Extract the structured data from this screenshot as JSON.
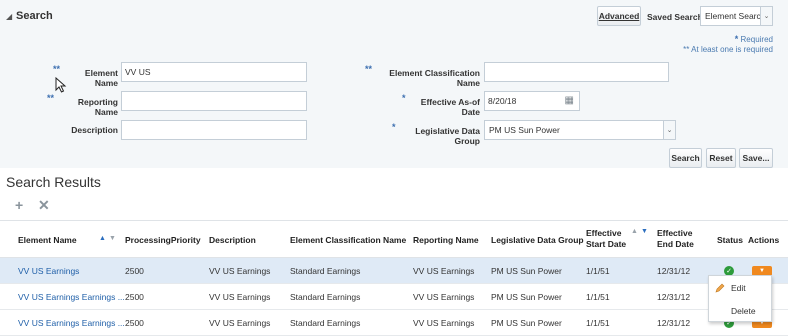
{
  "search": {
    "title": "Search",
    "advanced_label": "Advanced",
    "saved_search_label": "Saved Search",
    "saved_search_value": "Element Search",
    "required_note": "Required",
    "at_least_one_note": "** At least one is required",
    "fields": {
      "element_name_label": "Element Name",
      "element_name_value": "VV US",
      "reporting_name_label": "Reporting Name",
      "reporting_name_value": "",
      "description_label": "Description",
      "description_value": "",
      "classification_label": "Element Classification Name",
      "classification_value": "",
      "effective_date_label": "Effective As-of Date",
      "effective_date_value": "8/20/18",
      "ldg_label": "Legislative Data Group",
      "ldg_value": "PM US Sun Power"
    },
    "search_button": "Search",
    "reset_button": "Reset",
    "save_button": "Save..."
  },
  "results": {
    "title": "Search Results",
    "columns": {
      "element_name": "Element Name",
      "processing_priority": "ProcessingPriority",
      "description": "Description",
      "classification": "Element Classification Name",
      "reporting_name": "Reporting Name",
      "ldg": "Legislative Data Group",
      "start_date_1": "Effective",
      "start_date_2": "Start Date",
      "end_date_1": "Effective",
      "end_date_2": "End Date",
      "status": "Status",
      "actions": "Actions"
    },
    "rows": [
      {
        "name": "VV US Earnings",
        "priority": "2500",
        "description": "VV US Earnings",
        "classification": "Standard Earnings",
        "reporting": "VV US Earnings",
        "ldg": "PM US Sun Power",
        "start": "1/1/51",
        "end": "12/31/12"
      },
      {
        "name": "VV US Earnings Earnings ...",
        "priority": "2500",
        "description": "VV US Earnings",
        "classification": "Standard Earnings",
        "reporting": "VV US Earnings",
        "ldg": "PM US Sun Power",
        "start": "1/1/51",
        "end": "12/31/12"
      },
      {
        "name": "VV US Earnings Earnings ...",
        "priority": "2500",
        "description": "VV US Earnings",
        "classification": "Standard Earnings",
        "reporting": "VV US Earnings",
        "ldg": "PM US Sun Power",
        "start": "1/1/51",
        "end": "12/31/12"
      }
    ],
    "menu": {
      "edit": "Edit",
      "delete": "Delete"
    }
  },
  "colors": {
    "accent": "#1f5fa8",
    "action_orange": "#f0891f",
    "status_green": "#2d9b3b",
    "selected_row": "#dfeaf6"
  }
}
